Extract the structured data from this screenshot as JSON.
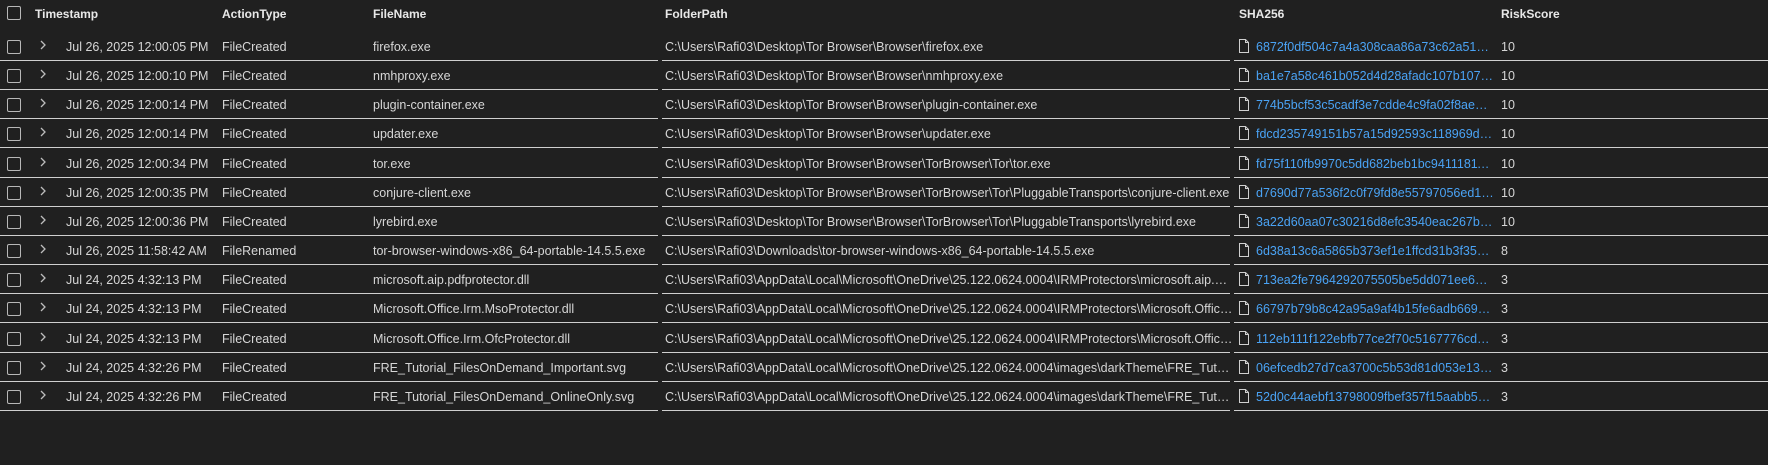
{
  "headers": {
    "timestamp": "Timestamp",
    "action_type": "ActionType",
    "file_name": "FileName",
    "folder_path": "FolderPath",
    "sha256": "SHA256",
    "risk_score": "RiskScore"
  },
  "colors": {
    "background": "#202020",
    "text": "#d6d6d6",
    "link": "#4aa3f5",
    "separator": "#cfcfcf"
  },
  "icons": {
    "expand": "chevron-right-icon",
    "hash_file": "file-icon"
  },
  "rows": [
    {
      "timestamp": "Jul 26, 2025 12:00:05 PM",
      "action_type": "FileCreated",
      "file_name": "firefox.exe",
      "folder_path": "C:\\Users\\Rafi03\\Desktop\\Tor Browser\\Browser\\firefox.exe",
      "sha256": "6872f0df504c7a4a308caa86a73c62a51bb...",
      "risk_score": "10"
    },
    {
      "timestamp": "Jul 26, 2025 12:00:10 PM",
      "action_type": "FileCreated",
      "file_name": "nmhproxy.exe",
      "folder_path": "C:\\Users\\Rafi03\\Desktop\\Tor Browser\\Browser\\nmhproxy.exe",
      "sha256": "ba1e7a58c461b052d4d28afadc107b1078...",
      "risk_score": "10"
    },
    {
      "timestamp": "Jul 26, 2025 12:00:14 PM",
      "action_type": "FileCreated",
      "file_name": "plugin-container.exe",
      "folder_path": "C:\\Users\\Rafi03\\Desktop\\Tor Browser\\Browser\\plugin-container.exe",
      "sha256": "774b5bcf53c5cadf3e7cdde4c9fa02f8ae99...",
      "risk_score": "10"
    },
    {
      "timestamp": "Jul 26, 2025 12:00:14 PM",
      "action_type": "FileCreated",
      "file_name": "updater.exe",
      "folder_path": "C:\\Users\\Rafi03\\Desktop\\Tor Browser\\Browser\\updater.exe",
      "sha256": "fdcd235749151b57a15d92593c118969d5...",
      "risk_score": "10"
    },
    {
      "timestamp": "Jul 26, 2025 12:00:34 PM",
      "action_type": "FileCreated",
      "file_name": "tor.exe",
      "folder_path": "C:\\Users\\Rafi03\\Desktop\\Tor Browser\\Browser\\TorBrowser\\Tor\\tor.exe",
      "sha256": "fd75f110fb9970c5dd682beb1bc94111811...",
      "risk_score": "10"
    },
    {
      "timestamp": "Jul 26, 2025 12:00:35 PM",
      "action_type": "FileCreated",
      "file_name": "conjure-client.exe",
      "folder_path": "C:\\Users\\Rafi03\\Desktop\\Tor Browser\\Browser\\TorBrowser\\Tor\\PluggableTransports\\conjure-client.exe",
      "sha256": "d7690d77a536f2c0f79fd8e55797056ed19...",
      "risk_score": "10"
    },
    {
      "timestamp": "Jul 26, 2025 12:00:36 PM",
      "action_type": "FileCreated",
      "file_name": "lyrebird.exe",
      "folder_path": "C:\\Users\\Rafi03\\Desktop\\Tor Browser\\Browser\\TorBrowser\\Tor\\PluggableTransports\\lyrebird.exe",
      "sha256": "3a22d60aa07c30216d8efc3540eac267bd9...",
      "risk_score": "10"
    },
    {
      "timestamp": "Jul 26, 2025 11:58:42 AM",
      "action_type": "FileRenamed",
      "file_name": "tor-browser-windows-x86_64-portable-14.5.5.exe",
      "folder_path": "C:\\Users\\Rafi03\\Downloads\\tor-browser-windows-x86_64-portable-14.5.5.exe",
      "sha256": "6d38a13c6a5865b373ef1e1ffcd31b3f359a...",
      "risk_score": "8"
    },
    {
      "timestamp": "Jul 24, 2025 4:32:13 PM",
      "action_type": "FileCreated",
      "file_name": "microsoft.aip.pdfprotector.dll",
      "folder_path": "C:\\Users\\Rafi03\\AppData\\Local\\Microsoft\\OneDrive\\25.122.0624.0004\\IRMProtectors\\microsoft.aip.pd...",
      "sha256": "713ea2fe7964292075505be5dd071ee63c...",
      "risk_score": "3"
    },
    {
      "timestamp": "Jul 24, 2025 4:32:13 PM",
      "action_type": "FileCreated",
      "file_name": "Microsoft.Office.Irm.MsoProtector.dll",
      "folder_path": "C:\\Users\\Rafi03\\AppData\\Local\\Microsoft\\OneDrive\\25.122.0624.0004\\IRMProtectors\\Microsoft.Office...",
      "sha256": "66797b79b8c42a95a9af4b15fe6adb669c1...",
      "risk_score": "3"
    },
    {
      "timestamp": "Jul 24, 2025 4:32:13 PM",
      "action_type": "FileCreated",
      "file_name": "Microsoft.Office.Irm.OfcProtector.dll",
      "folder_path": "C:\\Users\\Rafi03\\AppData\\Local\\Microsoft\\OneDrive\\25.122.0624.0004\\IRMProtectors\\Microsoft.Office...",
      "sha256": "112eb111f122ebfb77ce2f70c5167776cd7...",
      "risk_score": "3"
    },
    {
      "timestamp": "Jul 24, 2025 4:32:26 PM",
      "action_type": "FileCreated",
      "file_name": "FRE_Tutorial_FilesOnDemand_Important.svg",
      "folder_path": "C:\\Users\\Rafi03\\AppData\\Local\\Microsoft\\OneDrive\\25.122.0624.0004\\images\\darkTheme\\FRE_Tutori...",
      "sha256": "06efcedb27d7ca3700c5b53d81d053e133...",
      "risk_score": "3"
    },
    {
      "timestamp": "Jul 24, 2025 4:32:26 PM",
      "action_type": "FileCreated",
      "file_name": "FRE_Tutorial_FilesOnDemand_OnlineOnly.svg",
      "folder_path": "C:\\Users\\Rafi03\\AppData\\Local\\Microsoft\\OneDrive\\25.122.0624.0004\\images\\darkTheme\\FRE_Tutori...",
      "sha256": "52d0c44aebf13798009fbef357f15aabb55...",
      "risk_score": "3"
    }
  ]
}
